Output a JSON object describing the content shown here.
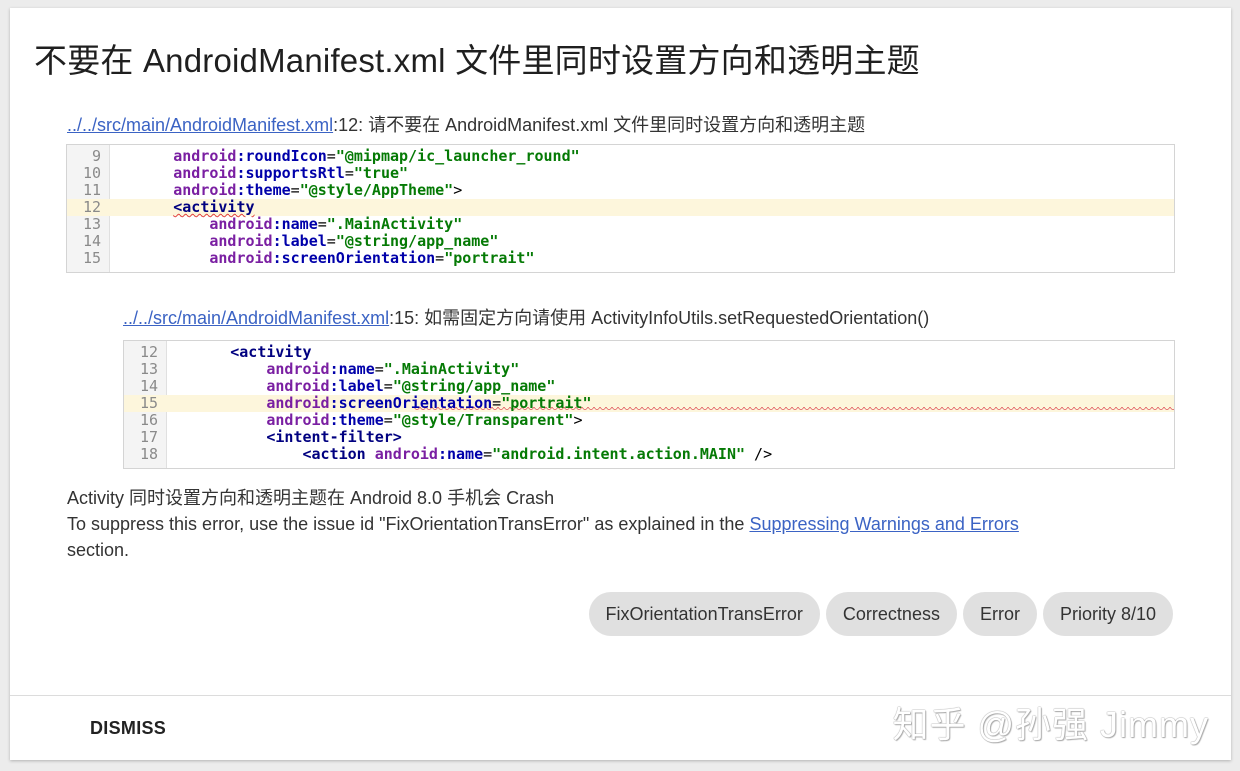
{
  "title": "不要在 AndroidManifest.xml 文件里同时设置方向和透明主题",
  "location1": {
    "link": "../../src/main/AndroidManifest.xml",
    "suffix": ":12: 请不要在 AndroidManifest.xml 文件里同时设置方向和透明主题"
  },
  "code1": {
    "lines": [
      {
        "n": "9"
      },
      {
        "n": "10"
      },
      {
        "n": "11"
      },
      {
        "n": "12"
      },
      {
        "n": "13"
      },
      {
        "n": "14"
      },
      {
        "n": "15"
      }
    ],
    "t": {
      "l9_a": "android",
      "l9_b": ":roundIcon",
      "l9_c": "=",
      "l9_d": "\"@mipmap/ic_launcher_round\"",
      "l10_a": "android",
      "l10_b": ":supportsRtl",
      "l10_c": "=",
      "l10_d": "\"true\"",
      "l11_a": "android",
      "l11_b": ":theme",
      "l11_c": "=",
      "l11_d": "\"@style/AppTheme\"",
      "l11_e": ">",
      "l12_a": "<activity",
      "l13_a": "android",
      "l13_b": ":name",
      "l13_c": "=",
      "l13_d": "\".MainActivity\"",
      "l14_a": "android",
      "l14_b": ":label",
      "l14_c": "=",
      "l14_d": "\"@string/app_name\"",
      "l15_a": "android",
      "l15_b": ":screenOrientation",
      "l15_c": "=",
      "l15_d": "\"portrait\""
    }
  },
  "location2": {
    "link": "../../src/main/AndroidManifest.xml",
    "suffix": ":15: 如需固定方向请使用 ActivityInfoUtils.setRequestedOrientation()"
  },
  "code2": {
    "lines": [
      {
        "n": "12"
      },
      {
        "n": "13"
      },
      {
        "n": "14"
      },
      {
        "n": "15"
      },
      {
        "n": "16"
      },
      {
        "n": "17"
      },
      {
        "n": "18"
      }
    ],
    "t": {
      "l12_a": "<activity",
      "l13_a": "android",
      "l13_b": ":name",
      "l13_c": "=",
      "l13_d": "\".MainActivity\"",
      "l14_a": "android",
      "l14_b": ":label",
      "l14_c": "=",
      "l14_d": "\"@string/app_name\"",
      "l15_a": "android",
      "l15_b": ":screenOrientation",
      "l15_c": "=",
      "l15_d": "\"portrait\"",
      "l16_a": "android",
      "l16_b": ":theme",
      "l16_c": "=",
      "l16_d": "\"@style/Transparent\"",
      "l16_e": ">",
      "l17_a": "<intent-filter>",
      "l18_a": "<action",
      "l18_b": "android",
      "l18_c": ":name",
      "l18_d": "=",
      "l18_e": "\"android.intent.action.MAIN\"",
      "l18_f": " />"
    }
  },
  "description": {
    "line1": "Activity 同时设置方向和透明主题在 Android 8.0 手机会 Crash",
    "line2_prefix": "To suppress this error, use the issue id \"FixOrientationTransError\" as explained in the ",
    "line2_link": "Suppressing Warnings and Errors",
    "line3": "section."
  },
  "chips": [
    "FixOrientationTransError",
    "Correctness",
    "Error",
    "Priority 8/10"
  ],
  "dismiss_label": "DISMISS",
  "watermark": "知乎 @孙强 Jimmy"
}
